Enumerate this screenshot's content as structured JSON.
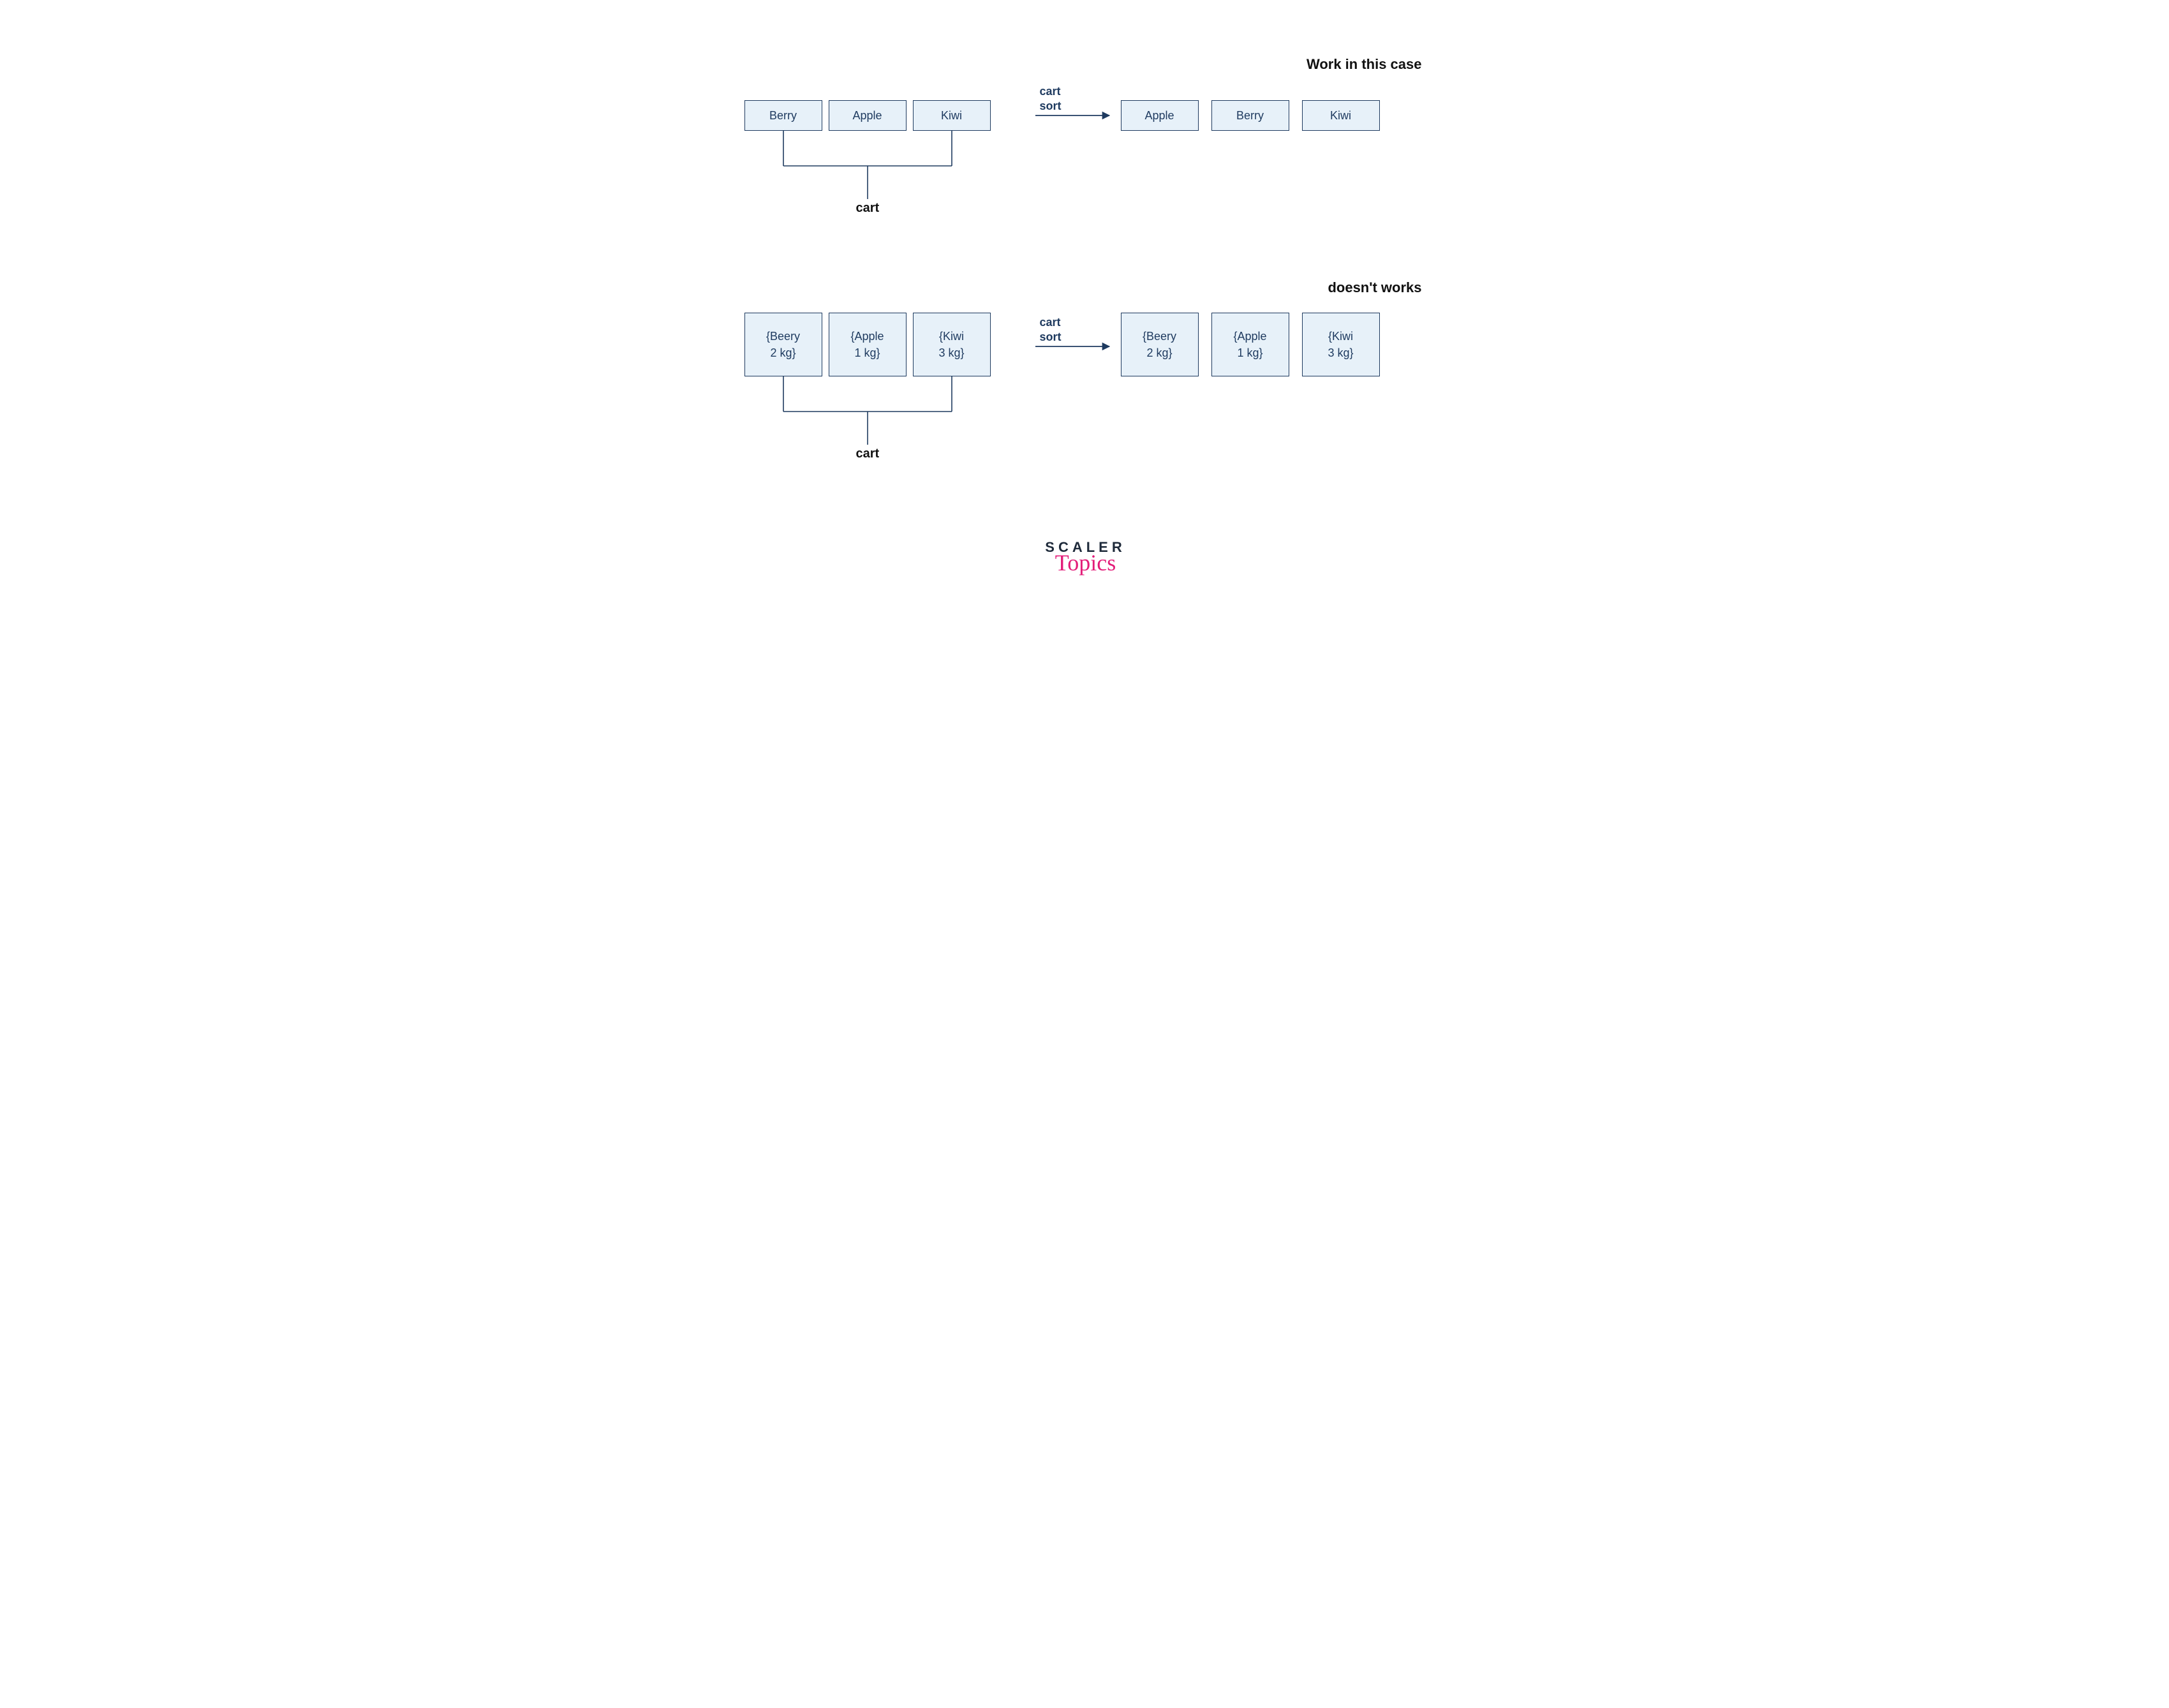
{
  "headings": {
    "works": "Work in this case",
    "doesnt": "doesn't works"
  },
  "arrow_label": {
    "line1": "cart",
    "line2": "sort"
  },
  "cart_label": "cart",
  "row1": {
    "left": [
      "Berry",
      "Apple",
      "Kiwi"
    ],
    "right": [
      "Apple",
      "Berry",
      "Kiwi"
    ]
  },
  "row2": {
    "left": [
      {
        "l1": "{Beery",
        "l2": "2 kg}"
      },
      {
        "l1": "{Apple",
        "l2": "1 kg}"
      },
      {
        "l1": "{Kiwi",
        "l2": "3 kg}"
      }
    ],
    "right": [
      {
        "l1": "{Beery",
        "l2": "2 kg}"
      },
      {
        "l1": "{Apple",
        "l2": "1 kg}"
      },
      {
        "l1": "{Kiwi",
        "l2": "3 kg}"
      }
    ]
  },
  "logo": {
    "line1": "SCALER",
    "line2": "Topics"
  }
}
